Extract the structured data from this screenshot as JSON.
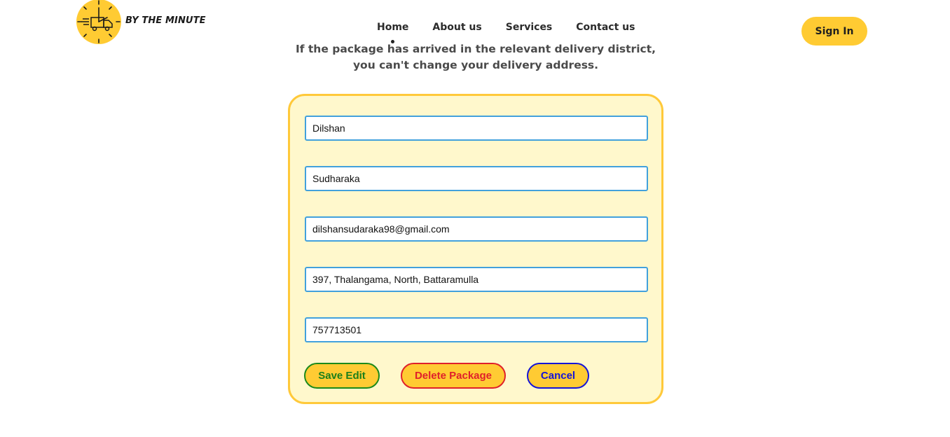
{
  "brand": {
    "name": "BY THE MINUTE",
    "logo_icon": "clock-delivery-truck-icon",
    "accent": "#ffcb33"
  },
  "nav": {
    "items": [
      {
        "label": "Home"
      },
      {
        "label": "About us"
      },
      {
        "label": "Services"
      },
      {
        "label": "Contact us"
      }
    ]
  },
  "header": {
    "signin_label": "Sign In"
  },
  "notice": {
    "line1": "If the package has arrived in the relevant delivery district,",
    "line2": "you can't change your delivery address."
  },
  "form": {
    "first_name": "Dilshan",
    "last_name": "Sudharaka",
    "email": "dilshansudaraka98@gmail.com",
    "address": "397, Thalangama, North, Battaramulla",
    "phone": "757713501",
    "save_label": "Save Edit",
    "delete_label": "Delete Package",
    "cancel_label": "Cancel"
  },
  "colors": {
    "card_bg": "#fff8cc",
    "card_border": "#ffc93a",
    "input_border": "#42a1dc",
    "save": "#1b8a1b",
    "delete": "#e0202a",
    "cancel": "#1414d8"
  }
}
